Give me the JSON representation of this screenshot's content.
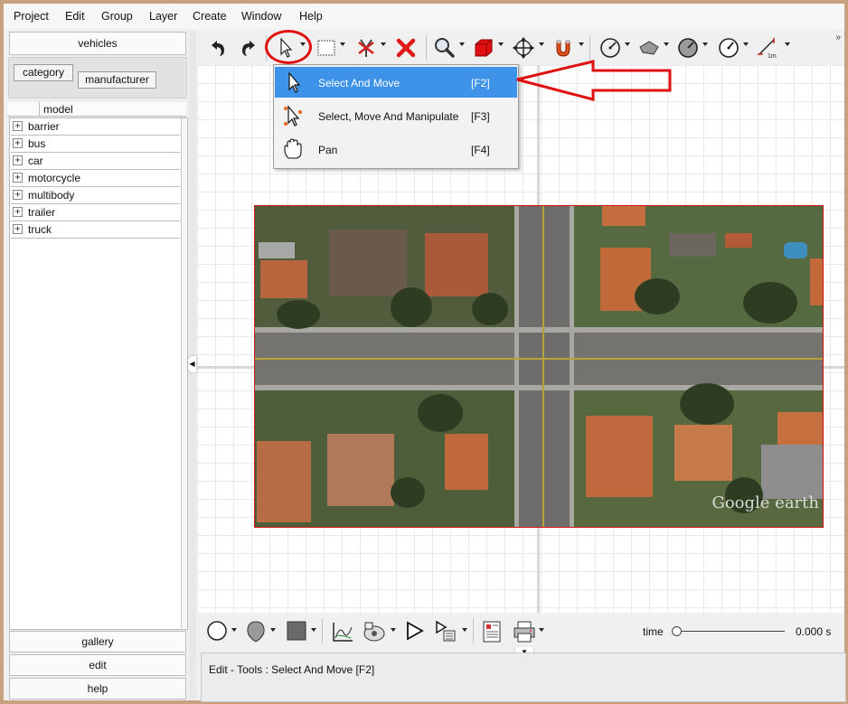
{
  "menubar": [
    "Project",
    "Edit",
    "Group",
    "Layer",
    "Create",
    "Window",
    "Help"
  ],
  "left_panel": {
    "title": "vehicles",
    "group_by": [
      "category",
      "manufacturer"
    ],
    "column_header": "model",
    "tree_items": [
      "barrier",
      "bus",
      "car",
      "motorcycle",
      "multibody",
      "trailer",
      "truck"
    ],
    "expand_glyph": "+",
    "bottom_buttons": [
      "gallery",
      "edit",
      "help"
    ]
  },
  "toolbar": {
    "icons": [
      "undo-icon",
      "redo-icon",
      "select-arrow-icon",
      "rectangle-select-icon",
      "delete-vertex-icon",
      "delete-icon",
      "zoom-icon",
      "box-3d-icon",
      "move-icon",
      "magnet-icon",
      "measure-circle-icon",
      "surface-icon",
      "gauge-icon",
      "compass-icon",
      "scale-icon"
    ],
    "scale_label": "1m",
    "overflow_glyph": "»"
  },
  "tool_menu": {
    "items": [
      {
        "label": "Select And Move",
        "shortcut": "[F2]",
        "icon": "arrow-cursor-icon",
        "selected": true
      },
      {
        "label": "Select, Move And Manipulate",
        "shortcut": "[F3]",
        "icon": "manipulate-cursor-icon",
        "selected": false
      },
      {
        "label": "Pan",
        "shortcut": "[F4]",
        "icon": "hand-icon",
        "selected": false
      }
    ]
  },
  "canvas": {
    "map_watermark": "Google earth"
  },
  "bottom_toolbar": {
    "icons": [
      "circle-icon",
      "blob-icon",
      "square-fill-icon",
      "chart-icon",
      "camera-icon",
      "play-icon",
      "sequence-icon",
      "report-icon",
      "print-icon"
    ],
    "time_label": "time",
    "time_value": "0.000 s",
    "time_position": 0.0
  },
  "status": {
    "text": "Edit - Tools : Select And Move [F2]"
  },
  "colors": {
    "menu_highlight": "#3e92e8",
    "annotation_red": "#e01010",
    "map_border": "#d01515"
  }
}
